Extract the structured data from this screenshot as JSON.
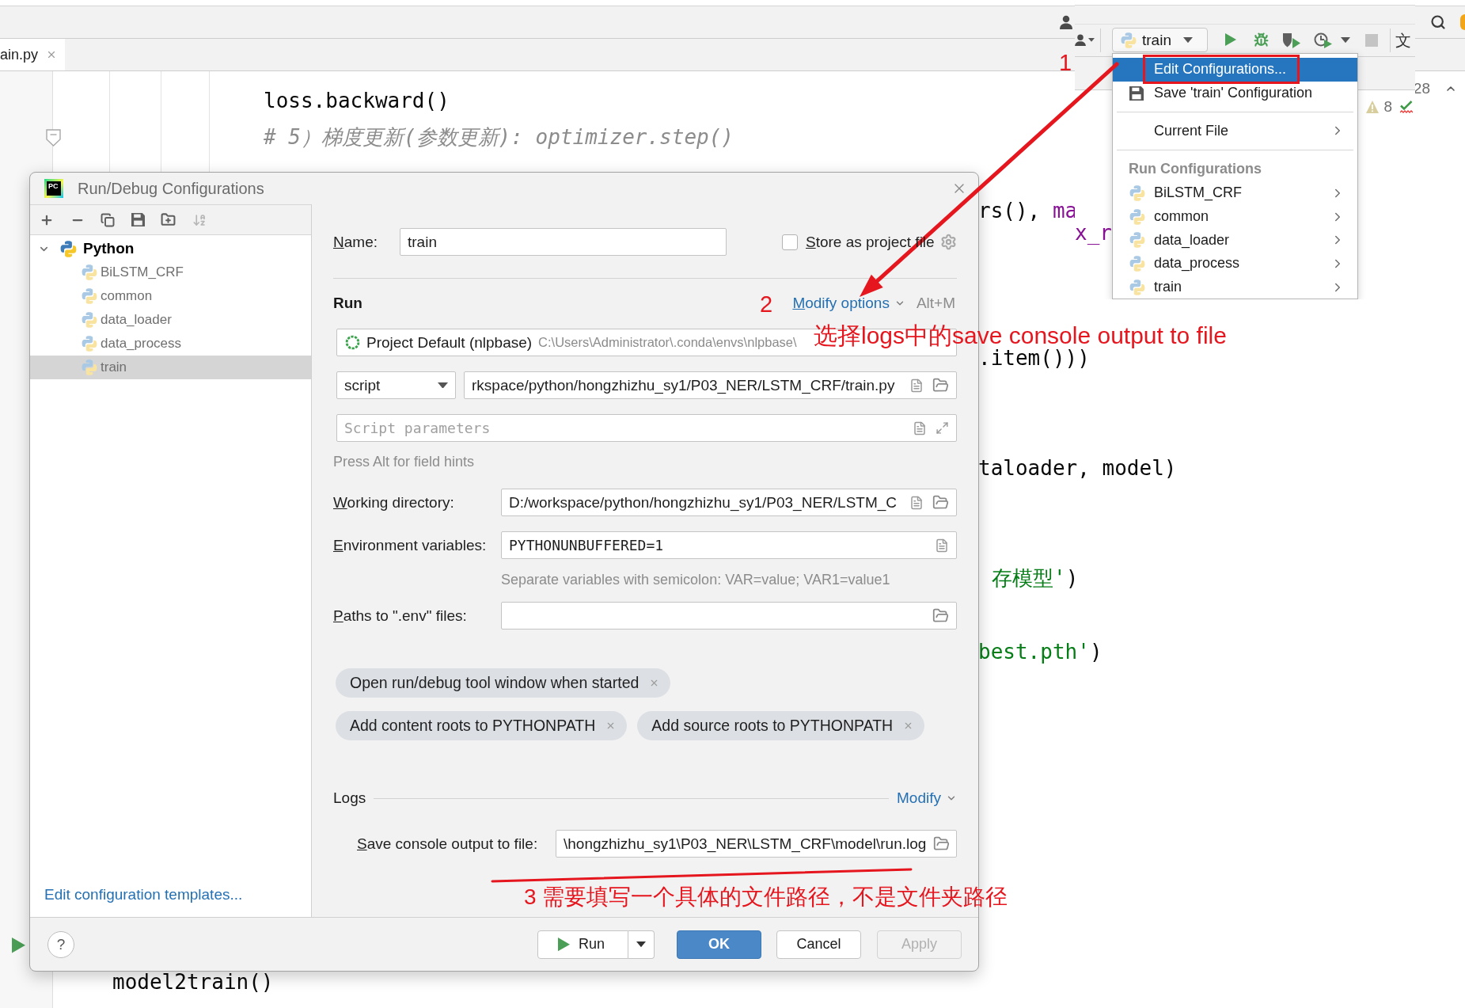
{
  "ide": {
    "tab": {
      "label": "ain.py"
    },
    "toolbar": {
      "run_config": "train",
      "glyph": "文"
    },
    "counter": "28",
    "warnings": "8"
  },
  "code": {
    "lines": [
      {
        "tokens": [
          {
            "kind": "plain",
            "text": "loss.backward()"
          }
        ]
      },
      {
        "tokens": [
          {
            "kind": "comment",
            "text": "# 5）梯度更新(参数更新): optimizer.step()"
          }
        ]
      },
      {
        "tokens": [
          {
            "kind": "plain",
            "text": "rs(), "
          },
          {
            "kind": "param",
            "text": "ma"
          }
        ]
      },
      {
        "tokens": [
          {
            "kind": "plain",
            "text": ".item()))"
          }
        ]
      },
      {
        "tokens": [
          {
            "kind": "plain",
            "text": "taloader, model)"
          }
        ]
      },
      {
        "tokens": [
          {
            "kind": "string",
            "text": "存模型'"
          },
          {
            "kind": "plain",
            "text": ")"
          }
        ]
      },
      {
        "tokens": [
          {
            "kind": "string",
            "text": "best.pth'"
          },
          {
            "kind": "plain",
            "text": ")"
          }
        ]
      },
      {
        "tokens": [
          {
            "kind": "plain",
            "text": "model2train()"
          }
        ]
      }
    ],
    "overlay_tokens": [
      {
        "kind": "param",
        "text": "x_r"
      }
    ]
  },
  "menu": {
    "items": [
      {
        "kind": "action",
        "label": "Edit Configurations...",
        "selected": true
      },
      {
        "kind": "action",
        "label": "Save 'train' Configuration",
        "selected": false
      },
      {
        "kind": "separator"
      },
      {
        "kind": "submenu",
        "label": "Current File",
        "selected": false
      },
      {
        "kind": "separator"
      },
      {
        "kind": "header",
        "label": "Run Configurations"
      },
      {
        "kind": "submenu",
        "label": "BiLSTM_CRF",
        "selected": false
      },
      {
        "kind": "submenu",
        "label": "common",
        "selected": false
      },
      {
        "kind": "submenu",
        "label": "data_loader",
        "selected": false
      },
      {
        "kind": "submenu",
        "label": "data_process",
        "selected": false
      },
      {
        "kind": "submenu",
        "label": "train",
        "selected": false
      }
    ]
  },
  "dialog": {
    "logo": "PC",
    "title": "Run/Debug Configurations",
    "tree": [
      {
        "label": "Python",
        "expanded": true,
        "selected": false,
        "children": [
          {
            "label": "BiLSTM_CRF",
            "selected": false
          },
          {
            "label": "common",
            "selected": false
          },
          {
            "label": "data_loader",
            "selected": false
          },
          {
            "label": "data_process",
            "selected": false
          },
          {
            "label": "train",
            "selected": true
          }
        ]
      }
    ],
    "templates_link": "Edit configuration templates...",
    "name": {
      "label": "Name:",
      "value": "train"
    },
    "store_as_project_file": {
      "label": "Store as project file",
      "checked": false
    },
    "run": {
      "title": "Run",
      "modify_link": "Modify options",
      "shortcut": "Alt+M"
    },
    "interpreter": {
      "name": "Project Default (nlpbase)",
      "path": "C:\\Users\\Administrator\\.conda\\envs\\nlpbase\\"
    },
    "target": {
      "type": "script",
      "path": "rkspace/python/hongzhizhu_sy1/P03_NER/LSTM_CRF/train.py"
    },
    "script_parameters": {
      "placeholder": "Script parameters"
    },
    "field_hint": "Press Alt for field hints",
    "fields": [
      {
        "kind": "browse",
        "label": "Working directory:",
        "value": "D:/workspace/python/hongzhizhu_sy1/P03_NER/LSTM_C"
      },
      {
        "kind": "env",
        "label": "Environment variables:",
        "value": "PYTHONUNBUFFERED=1",
        "hint": "Separate variables with semicolon: VAR=value; VAR1=value1"
      },
      {
        "kind": "folder",
        "label": "Paths to \".env\" files:"
      }
    ],
    "option_rows": [
      {
        "chips": [
          {
            "label": "Open run/debug tool window when started"
          }
        ]
      },
      {
        "chips": [
          {
            "label": "Add content roots to PYTHONPATH"
          },
          {
            "label": "Add source roots to PYTHONPATH"
          }
        ]
      }
    ],
    "logs": {
      "title": "Logs",
      "modify_link": "Modify",
      "save_console": {
        "label": "Save console output to file:",
        "value": "\\hongzhizhu_sy1\\P03_NER\\LSTM_CRF\\model\\run.log"
      }
    },
    "help": "?",
    "buttons": [
      {
        "kind": "split",
        "label": "Run",
        "disabled": false
      },
      {
        "kind": "primary",
        "label": "OK",
        "disabled": false
      },
      {
        "kind": "default",
        "label": "Cancel",
        "disabled": false
      },
      {
        "kind": "default",
        "label": "Apply",
        "disabled": true
      }
    ]
  },
  "annotations": [
    {
      "kind": "number",
      "text": "1"
    },
    {
      "kind": "number",
      "text": "2"
    },
    {
      "kind": "note",
      "text": "选择logs中的save console output to file"
    },
    {
      "kind": "note",
      "text": "3 需要填写一个具体的文件路径，不是文件夹路径"
    }
  ]
}
